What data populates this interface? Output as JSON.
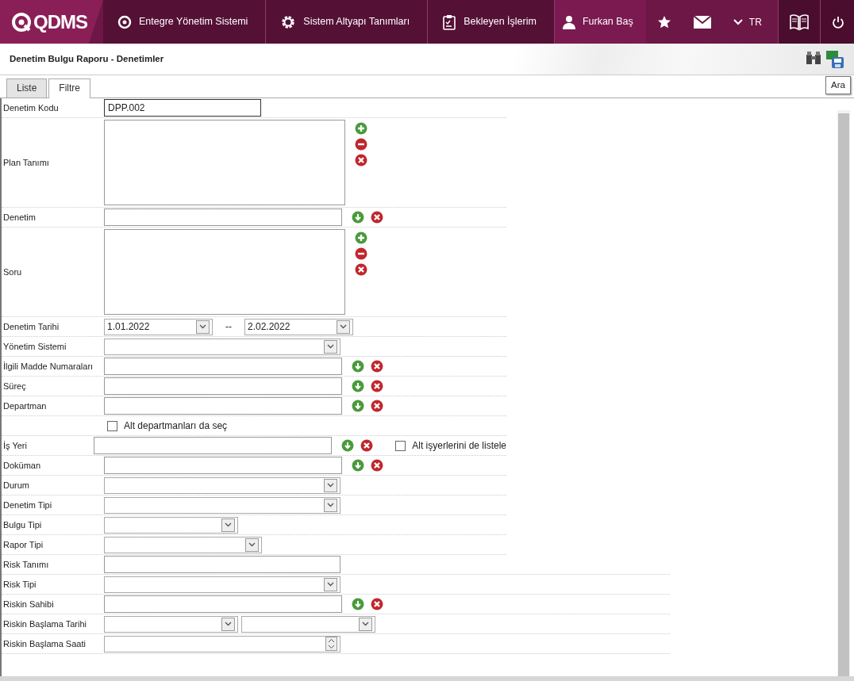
{
  "navbar": {
    "brand": "QDMS",
    "items": [
      {
        "label": "Entegre Yönetim Sistemi",
        "kind": "menu"
      },
      {
        "label": "Sistem Altyapı Tanımları",
        "kind": "menu"
      },
      {
        "label": "Bekleyen İşlerim",
        "kind": "menu"
      },
      {
        "label": "Furkan Baş",
        "kind": "user"
      }
    ],
    "language": "TR"
  },
  "page_title": "Denetim Bulgu Raporu - Denetimler",
  "tooltip": "Ara",
  "tabs": [
    {
      "label": "Liste",
      "selected": false
    },
    {
      "label": "Filtre",
      "selected": true
    }
  ],
  "rows": [
    {
      "label": "Denetim Kodu",
      "kind": "short-text",
      "value": "DPP.002"
    },
    {
      "label": "Plan Tanımı",
      "kind": "list"
    },
    {
      "label": "Denetim",
      "kind": "lookup"
    },
    {
      "label": "Soru",
      "kind": "list"
    },
    {
      "label": "Denetim Tarihi",
      "kind": "date-range",
      "from": "1.01.2022",
      "separator": "--",
      "to": "2.02.2022"
    },
    {
      "label": "Yönetim Sistemi",
      "kind": "select"
    },
    {
      "label": "İlgili Madde Numaraları",
      "kind": "lookup"
    },
    {
      "label": "Süreç",
      "kind": "lookup"
    },
    {
      "label": "Departman",
      "kind": "lookup"
    },
    {
      "kind": "checkbox",
      "option": {
        "label": "Alt departmanları da seç",
        "checked": false
      }
    },
    {
      "label": "İş Yeri",
      "kind": "lookup",
      "option": {
        "label": "Alt işyerlerini de listele",
        "checked": false
      }
    },
    {
      "label": "Doküman",
      "kind": "lookup"
    },
    {
      "label": "Durum",
      "kind": "select"
    },
    {
      "label": "Denetim Tipi",
      "kind": "select"
    },
    {
      "label": "Bulgu Tipi",
      "kind": "small-select"
    },
    {
      "label": "Rapor Tipi",
      "kind": "medium-select"
    },
    {
      "label": "Risk Tanımı",
      "kind": "text"
    },
    {
      "label": "Risk Tipi",
      "kind": "select"
    },
    {
      "label": "Riskin Sahibi",
      "kind": "lookup"
    },
    {
      "label": "Riskin Başlama Tarihi",
      "kind": "double-select"
    },
    {
      "label": "Riskin Başlama Saati",
      "kind": "spinner"
    }
  ]
}
